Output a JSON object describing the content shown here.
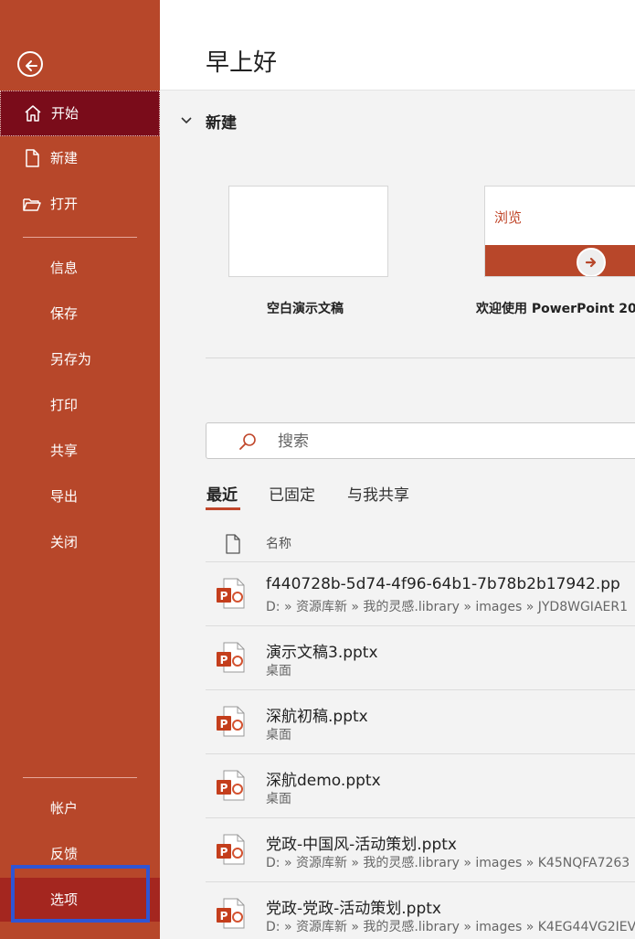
{
  "sidebar": {
    "back_icon": "back-arrow-icon",
    "top_items": [
      {
        "label": "开始",
        "icon": "home-icon",
        "selected": true
      },
      {
        "label": "新建",
        "icon": "new-file-icon"
      },
      {
        "label": "打开",
        "icon": "open-folder-icon"
      }
    ],
    "mid_items": [
      {
        "label": "信息"
      },
      {
        "label": "保存"
      },
      {
        "label": "另存为"
      },
      {
        "label": "打印"
      },
      {
        "label": "共享"
      },
      {
        "label": "导出"
      },
      {
        "label": "关闭"
      }
    ],
    "bottom_items": [
      {
        "label": "帐户"
      },
      {
        "label": "反馈"
      },
      {
        "label": "选项",
        "highlighted": true
      }
    ]
  },
  "header": {
    "greeting": "早上好"
  },
  "new_section": {
    "label": "新建",
    "templates": [
      {
        "caption": "空白演示文稿"
      },
      {
        "caption": "欢迎使用 PowerPoint 20",
        "thumb_text": "浏览"
      }
    ]
  },
  "search": {
    "placeholder": "搜索"
  },
  "tabs": [
    {
      "label": "最近",
      "active": true
    },
    {
      "label": "已固定"
    },
    {
      "label": "与我共享"
    }
  ],
  "list": {
    "column_name": "名称",
    "files": [
      {
        "name": "f440728b-5d74-4f96-64b1-7b78b2b17942.pp",
        "path": "D: » 资源库新 » 我的灵感.library » images » JYD8WGIAER1"
      },
      {
        "name": "演示文稿3.pptx",
        "path": "桌面"
      },
      {
        "name": "深航初稿.pptx",
        "path": "桌面"
      },
      {
        "name": "深航demo.pptx",
        "path": "桌面"
      },
      {
        "name": "党政-中国风-活动策划.pptx",
        "path": "D: » 资源库新 » 我的灵感.library » images » K45NQFA7263"
      },
      {
        "name": "党政-党政-活动策划.pptx",
        "path": "D: » 资源库新 » 我的灵感.library » images » K4EG44VG2IEV"
      }
    ]
  },
  "colors": {
    "accent": "#b7472a",
    "selected": "#7a0c1a",
    "highlight_outline": "#2f55d4"
  }
}
